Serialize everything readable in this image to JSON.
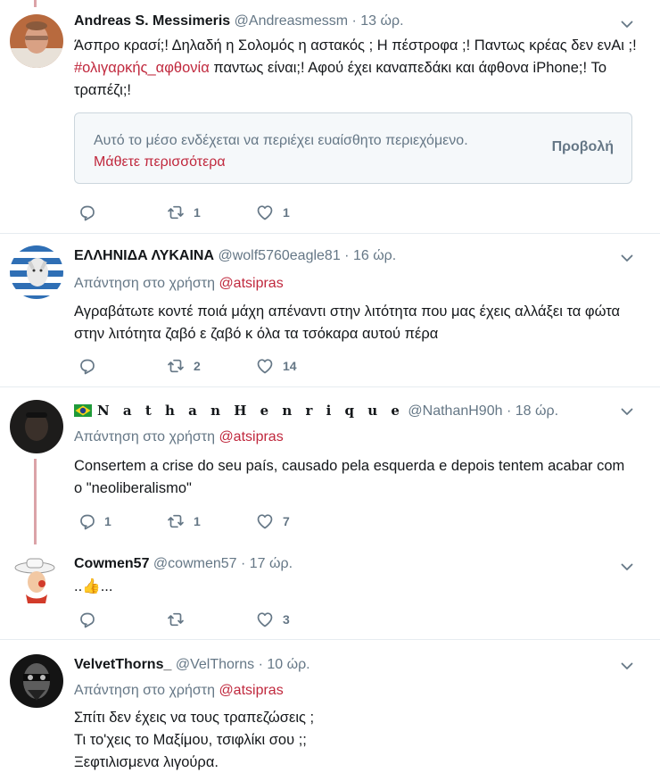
{
  "tweets": [
    {
      "name": "Andreas S. Messimeris",
      "handle": "@Andreasmessm",
      "time": "· 13 ώρ.",
      "text_pre": "Άσπρο κρασί;! Δηλαδή η Σολομός η αστακός ; Η πέστροφα ;! Παντως κρέας δεν ενΑι ;! ",
      "hashtag": "#ολιγαρκής_αφθονία",
      "text_post": " παντως είναι;! Αφού έχει καναπεδάκι και άφθονα iPhone;! Το τραπέζι;!",
      "sensitive_text": "Αυτό το μέσο ενδέχεται να περιέχει ευαίσθητο περιεχόμενο.",
      "sensitive_link": "Μάθετε περισσότερα",
      "sensitive_button": "Προβολή",
      "replies": "",
      "retweets": "1",
      "likes": "1"
    },
    {
      "name": "ΕΛΛΗΝΙΔΑ ΛΥΚΑΙΝΑ",
      "handle": "@wolf5760eagle81",
      "time": "· 16 ώρ.",
      "reply_label": "Απάντηση στο χρήστη",
      "reply_mention": "@atsipras",
      "text": "Αγραβάτωτε κοντέ ποιά μάχη απέναντι στην λιτότητα που μας έχεις αλλάξει τα φώτα στην λιτότητα ζαβό ε ζαβό κ όλα τα τσόκαρα αυτού πέρα",
      "replies": "",
      "retweets": "2",
      "likes": "14"
    },
    {
      "name": "N a t h a n H e n r i q u e",
      "handle": "@NathanH90h",
      "time": "· 18 ώρ.",
      "reply_label": "Απάντηση στο χρήστη",
      "reply_mention": "@atsipras",
      "text": "Consertem a crise do seu país, causado pela esquerda e depois tentem acabar com o \"neoliberalismo\"",
      "replies": "1",
      "retweets": "1",
      "likes": "7"
    },
    {
      "name": "Cowmen57",
      "handle": "@cowmen57",
      "time": "· 17 ώρ.",
      "text": "..👍...",
      "replies": "",
      "retweets": "",
      "likes": "3"
    },
    {
      "name": "VelvetThorns_",
      "handle": "@VelThorns",
      "time": "· 10 ώρ.",
      "reply_label": "Απάντηση στο χρήστη",
      "reply_mention": "@atsipras",
      "text_lines": [
        "Σπίτι δεν έχεις να τους τραπεζώσεις ;",
        "Τι το'χεις το Μαξίμου, τσιφλίκι σου ;;",
        "Ξεφτιλισμενα λιγούρα."
      ]
    }
  ],
  "colors": {
    "accent": "#c0283d",
    "muted": "#657786",
    "thread": "#dba3a8"
  }
}
